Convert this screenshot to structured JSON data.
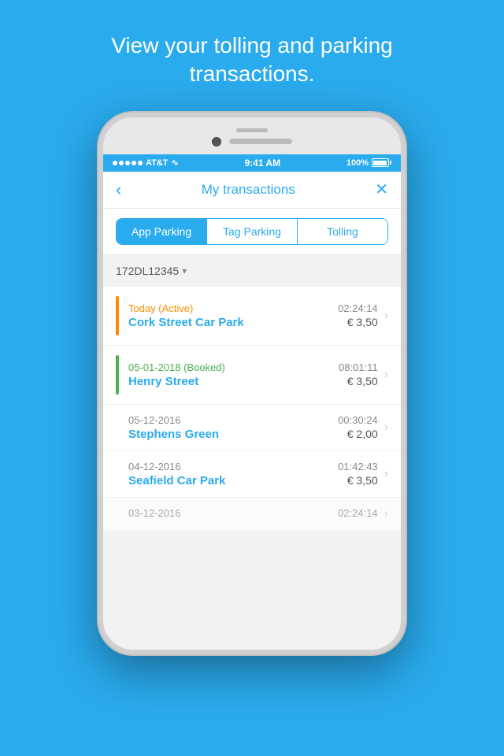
{
  "header": {
    "title": "View your tolling and parking transactions."
  },
  "status_bar": {
    "carrier": "AT&T",
    "time": "9:41 AM",
    "battery": "100%"
  },
  "nav": {
    "title": "My transactions",
    "back_label": "‹",
    "close_label": "✕"
  },
  "tabs": [
    {
      "id": "app-parking",
      "label": "App Parking",
      "active": true
    },
    {
      "id": "tag-parking",
      "label": "Tag Parking",
      "active": false
    },
    {
      "id": "tolling",
      "label": "Tolling",
      "active": false
    }
  ],
  "vehicle_selector": {
    "value": "172DL12345",
    "dropdown_symbol": "▾"
  },
  "transactions": [
    {
      "id": "1",
      "bar_color": "orange",
      "date": "Today (Active)",
      "date_style": "active",
      "location": "Cork Street Car Park",
      "time": "02:24:14",
      "amount": "€ 3,50"
    },
    {
      "id": "2",
      "bar_color": "green",
      "date": "05-01-2018 (Booked)",
      "date_style": "booked",
      "location": "Henry Street",
      "time": "08:01:11",
      "amount": "€ 3,50"
    },
    {
      "id": "3",
      "bar_color": "none",
      "date": "05-12-2016",
      "date_style": "past",
      "location": "Stephens Green",
      "time": "00:30:24",
      "amount": "€ 2,00"
    },
    {
      "id": "4",
      "bar_color": "none",
      "date": "04-12-2016",
      "date_style": "past",
      "location": "Seafield Car Park",
      "time": "01:42:43",
      "amount": "€ 3,50"
    },
    {
      "id": "5",
      "bar_color": "none",
      "date": "03-12-2016",
      "date_style": "past",
      "location": "",
      "time": "02:24:14",
      "amount": ""
    }
  ]
}
